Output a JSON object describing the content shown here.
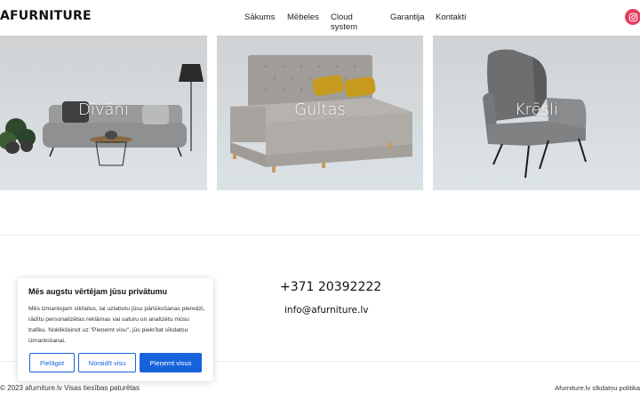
{
  "header": {
    "logo": "AFURNITURE",
    "nav": [
      "Sākums",
      "Mēbeles",
      "Cloud system",
      "Garantija",
      "Kontakti"
    ],
    "social_icon": "instagram-icon"
  },
  "categories": [
    {
      "label": "Dīvāni"
    },
    {
      "label": "Gultas"
    },
    {
      "label": "Krēsli"
    }
  ],
  "contact": {
    "phone": "+371 20392222",
    "email": "info@afurniture.lv"
  },
  "footer": {
    "copyright": "© 2023 afurniture.lv Visas tiesības paturētas",
    "privacy_link": "Afurniture.lv sīkdatņu politika"
  },
  "cookie_banner": {
    "title": "Mēs augstu vērtējam jūsu privātumu",
    "text": "Mēs izmantojam sīkfailus, lai uzlabotu jūsu pārlūkošanas pieredzi, rādītu personalizētas reklāmas vai saturu un analizētu mūsu trafiku. Noklikšķinot uz \"Pieņemt visu\", jūs piekrītat sīkdatņu izmantošanai.",
    "buttons": {
      "customize": "Pielāgot",
      "reject": "Noraidīt visu",
      "accept": "Pieņemt visus"
    },
    "accent": "#1863dc"
  }
}
